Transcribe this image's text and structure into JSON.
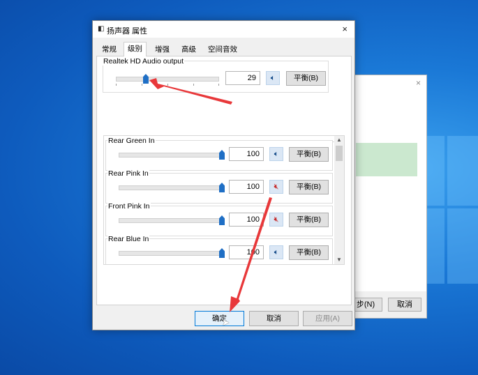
{
  "background_dialog": {
    "next_label": "步(N)",
    "cancel_label": "取消",
    "close_glyph": "×"
  },
  "dialog": {
    "title": "扬声器 属性",
    "close_glyph": "×",
    "tabs": [
      {
        "label": "常规",
        "active": false
      },
      {
        "label": "级别",
        "active": true
      },
      {
        "label": "增强",
        "active": false
      },
      {
        "label": "高级",
        "active": false
      },
      {
        "label": "空间音效",
        "active": false
      }
    ],
    "master": {
      "label": "Realtek HD Audio output",
      "value": "29",
      "level": 29,
      "balance_label": "平衡(B)"
    },
    "inputs": [
      {
        "label": "Rear Green In",
        "value": "100",
        "level": 100,
        "muted": false,
        "balance_label": "平衡(B)"
      },
      {
        "label": "Rear Pink In",
        "value": "100",
        "level": 100,
        "muted": true,
        "balance_label": "平衡(B)"
      },
      {
        "label": "Front Pink In",
        "value": "100",
        "level": 100,
        "muted": true,
        "balance_label": "平衡(B)"
      },
      {
        "label": "Rear Blue In",
        "value": "100",
        "level": 100,
        "muted": false,
        "balance_label": "平衡(B)"
      }
    ],
    "buttons": {
      "ok": "确定",
      "cancel": "取消",
      "apply": "应用(A)"
    }
  },
  "icons": {
    "speaker": "speaker-icon",
    "speaker_muted": "speaker-muted-icon",
    "cursor": "mouse-cursor-icon"
  },
  "colors": {
    "accent": "#1f6fc5",
    "annotation_arrow": "#e8383a",
    "desktop": "#1a78d6"
  }
}
